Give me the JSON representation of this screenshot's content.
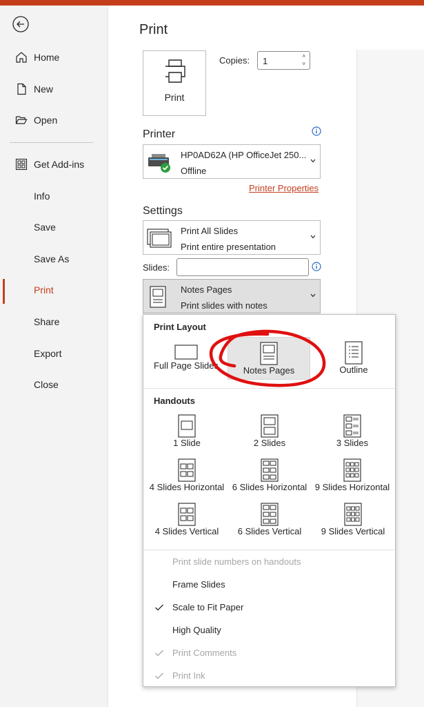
{
  "nav": {
    "items": [
      {
        "label": "Home",
        "icon": "home-icon"
      },
      {
        "label": "New",
        "icon": "new-document-icon"
      },
      {
        "label": "Open",
        "icon": "folder-open-icon"
      },
      {
        "label": "Get Add-ins",
        "icon": "add-ins-grid-icon"
      },
      {
        "label": "Info"
      },
      {
        "label": "Save"
      },
      {
        "label": "Save As"
      },
      {
        "label": "Print",
        "active": true
      },
      {
        "label": "Share"
      },
      {
        "label": "Export"
      },
      {
        "label": "Close"
      }
    ]
  },
  "page": {
    "title": "Print"
  },
  "print": {
    "button_label": "Print",
    "copies_label": "Copies:",
    "copies_value": "1"
  },
  "printer": {
    "section_label": "Printer",
    "name": "HP0AD62A (HP OfficeJet 250...",
    "status": "Offline",
    "properties_link": "Printer Properties"
  },
  "settings": {
    "section_label": "Settings",
    "range_title": "Print All Slides",
    "range_sub": "Print entire presentation",
    "slides_label": "Slides:",
    "slides_value": "",
    "layout_title": "Notes Pages",
    "layout_sub": "Print slides with notes"
  },
  "popup": {
    "print_layout_title": "Print Layout",
    "print_layout": [
      "Full Page Slides",
      "Notes Pages",
      "Outline"
    ],
    "selected": "Notes Pages",
    "handouts_title": "Handouts",
    "handouts": [
      "1 Slide",
      "2 Slides",
      "3 Slides",
      "4 Slides Horizontal",
      "6 Slides Horizontal",
      "9 Slides Horizontal",
      "4 Slides Vertical",
      "6 Slides Vertical",
      "9 Slides Vertical"
    ],
    "options": [
      {
        "label": "Print slide numbers on handouts",
        "checked": false,
        "disabled": true
      },
      {
        "label": "Frame Slides",
        "checked": false,
        "disabled": false
      },
      {
        "label": "Scale to Fit Paper",
        "checked": true,
        "disabled": false
      },
      {
        "label": "High Quality",
        "checked": false,
        "disabled": false
      },
      {
        "label": "Print Comments",
        "checked": true,
        "disabled": true
      },
      {
        "label": "Print Ink",
        "checked": true,
        "disabled": true
      }
    ]
  },
  "colors": {
    "accent": "#c43e1c",
    "annotation": "#e01010",
    "success": "#2e9e3f"
  }
}
